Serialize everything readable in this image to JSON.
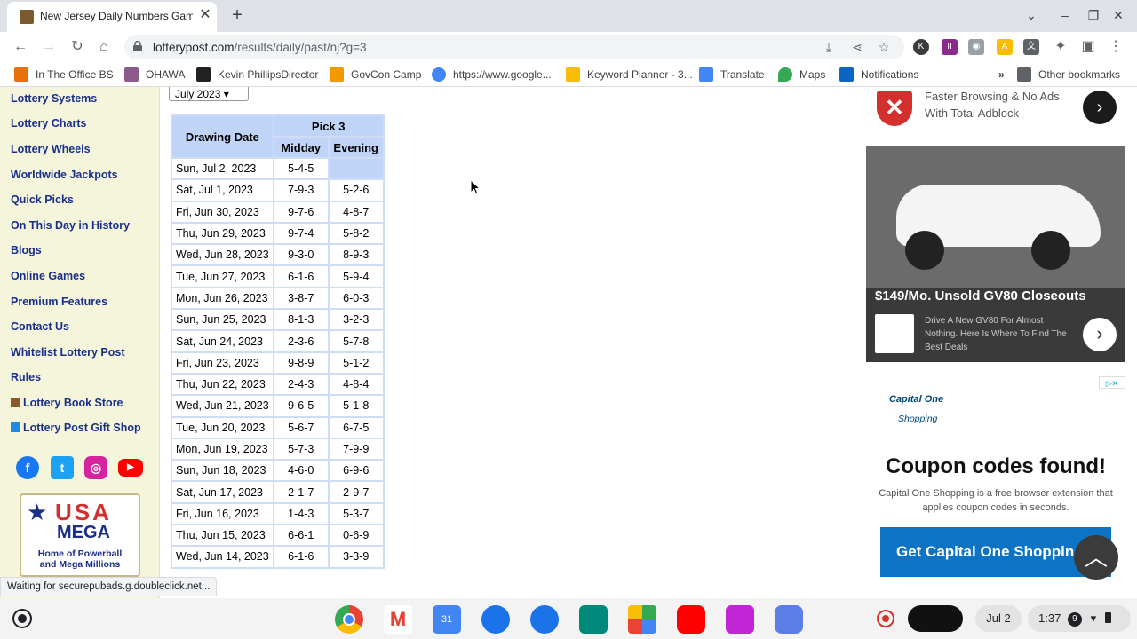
{
  "browser": {
    "tab_title": "New Jersey Daily Numbers Game",
    "close_glyph": "✕",
    "newtab_glyph": "+",
    "url_domain": "lotterypost.com",
    "url_path": "/results/daily/past/nj?g=3"
  },
  "bookmarks": [
    {
      "label": "In The Office BS",
      "color": "#e8710a"
    },
    {
      "label": "OHAWA",
      "color": "#8b5a8b"
    },
    {
      "label": "Kevin PhillipsDirector",
      "color": "#222222"
    },
    {
      "label": "GovCon Camp",
      "color": "#f29900"
    },
    {
      "label": "https://www.google...",
      "color": "#4285f4"
    },
    {
      "label": "Keyword Planner - 3...",
      "color": "#fbbc04"
    },
    {
      "label": "Translate",
      "color": "#4285f4"
    },
    {
      "label": "Maps",
      "color": "#34a853"
    },
    {
      "label": "Notifications",
      "color": "#0a66c2"
    }
  ],
  "bookmarks_overflow": "»",
  "other_bookmarks": "Other bookmarks",
  "sidebar": {
    "links": [
      "Lottery Systems",
      "Lottery Charts",
      "Lottery Wheels",
      "Worldwide Jackpots",
      "Quick Picks",
      "On This Day in History",
      "Blogs",
      "Online Games",
      "Premium Features",
      "Contact Us",
      "Whitelist Lottery Post",
      "Rules",
      "Lottery Book Store",
      "Lottery Post Gift Shop"
    ],
    "logo_line1": "USA",
    "logo_line2": "MEGA",
    "logo_line3": "Home of Powerball",
    "logo_line4": "and Mega Millions"
  },
  "results": {
    "month_select": "July 2023",
    "header_date": "Drawing Date",
    "header_game": "Pick 3",
    "header_midday": "Midday",
    "header_evening": "Evening",
    "rows": [
      [
        "Sun, Jul 2, 2023",
        "5-4-5",
        ""
      ],
      [
        "Sat, Jul 1, 2023",
        "7-9-3",
        "5-2-6"
      ],
      [
        "Fri, Jun 30, 2023",
        "9-7-6",
        "4-8-7"
      ],
      [
        "Thu, Jun 29, 2023",
        "9-7-4",
        "5-8-2"
      ],
      [
        "Wed, Jun 28, 2023",
        "9-3-0",
        "8-9-3"
      ],
      [
        "Tue, Jun 27, 2023",
        "6-1-6",
        "5-9-4"
      ],
      [
        "Mon, Jun 26, 2023",
        "3-8-7",
        "6-0-3"
      ],
      [
        "Sun, Jun 25, 2023",
        "8-1-3",
        "3-2-3"
      ],
      [
        "Sat, Jun 24, 2023",
        "2-3-6",
        "5-7-8"
      ],
      [
        "Fri, Jun 23, 2023",
        "9-8-9",
        "5-1-2"
      ],
      [
        "Thu, Jun 22, 2023",
        "2-4-3",
        "4-8-4"
      ],
      [
        "Wed, Jun 21, 2023",
        "9-6-5",
        "5-1-8"
      ],
      [
        "Tue, Jun 20, 2023",
        "5-6-7",
        "6-7-5"
      ],
      [
        "Mon, Jun 19, 2023",
        "5-7-3",
        "7-9-9"
      ],
      [
        "Sun, Jun 18, 2023",
        "4-6-0",
        "6-9-6"
      ],
      [
        "Sat, Jun 17, 2023",
        "2-1-7",
        "2-9-7"
      ],
      [
        "Fri, Jun 16, 2023",
        "1-4-3",
        "5-3-7"
      ],
      [
        "Thu, Jun 15, 2023",
        "6-6-1",
        "0-6-9"
      ],
      [
        "Wed, Jun 14, 2023",
        "6-1-6",
        "3-3-9"
      ]
    ]
  },
  "ads": {
    "adblock_line1": "Faster Browsing & No Ads",
    "adblock_line2": "With Total Adblock",
    "car_headline": "$149/Mo. Unsold GV80 Closeouts",
    "car_sub": "Drive A New GV80 For Almost Nothing. Here Is Where To Find The Best Deals",
    "capone_brand": "Capital One",
    "capone_sub": "Shopping",
    "capone_headline": "Coupon codes found!",
    "capone_body": "Capital One Shopping is a free browser extension that applies coupon codes in seconds.",
    "capone_cta": "Get Capital One Shopping"
  },
  "status_text": "Waiting for securepubads.g.doubleclick.net...",
  "shelf": {
    "date": "Jul 2",
    "time": "1:37",
    "notif_count": "9"
  },
  "colors": {
    "sidebar_link": "#1a2f8a",
    "table_header": "#c0d4f7",
    "capone_cta": "#0d74c5"
  }
}
